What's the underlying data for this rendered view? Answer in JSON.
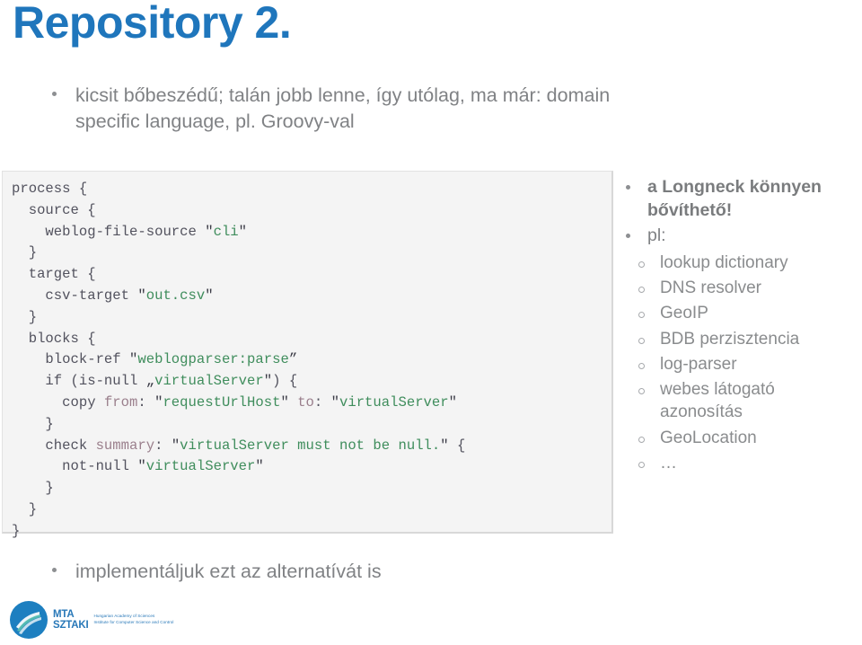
{
  "slide": {
    "title": "Repository 2."
  },
  "top_bullet": {
    "marker": "bullet-dot",
    "text": "kicsit bőbeszédű; talán jobb lenne, így utólag, ma már: domain specific language, pl. Groovy-val"
  },
  "code_block": {
    "language": "longneck-dsl",
    "background_color": "#f4f4f4",
    "keyword_color": "#52525e",
    "string_color": "#3f8d5c",
    "lines": [
      "process {",
      "  source {",
      "    weblog-file-source \"cli\"",
      "  }",
      "  target {",
      "    csv-target \"out.csv\"",
      "  }",
      "  blocks {",
      "    block-ref \"weblogparser:parse”",
      "    if (is-null „virtualServer\") {",
      "      copy from: \"requestUrlHost\" to: \"virtualServer\"",
      "    }",
      "    check summary: \"virtualServer must not be null.\" {",
      "      not-null \"virtualServer\"",
      "    }",
      "  }",
      "}"
    ]
  },
  "bottom_bullet": {
    "text": "implementáljuk ezt az alternatívát is"
  },
  "right_column": {
    "bullets": [
      {
        "text": "a Longneck könnyen bővíthető!",
        "bold": true
      },
      {
        "text": "pl:",
        "bold": false
      }
    ],
    "sub_items": [
      "lookup dictionary",
      "DNS resolver",
      "GeoIP",
      "BDB perzisztencia",
      "log-parser",
      "webes látogató azonosítás",
      "GeoLocation",
      "…"
    ]
  },
  "logo": {
    "acronym_line1": "MTA",
    "acronym_line2": "SZTAKI",
    "tagline_line1": "Hungarian Academy of Sciences",
    "tagline_line2": "Institute for Computer Science and Control",
    "brand_color": "#2878b8"
  }
}
